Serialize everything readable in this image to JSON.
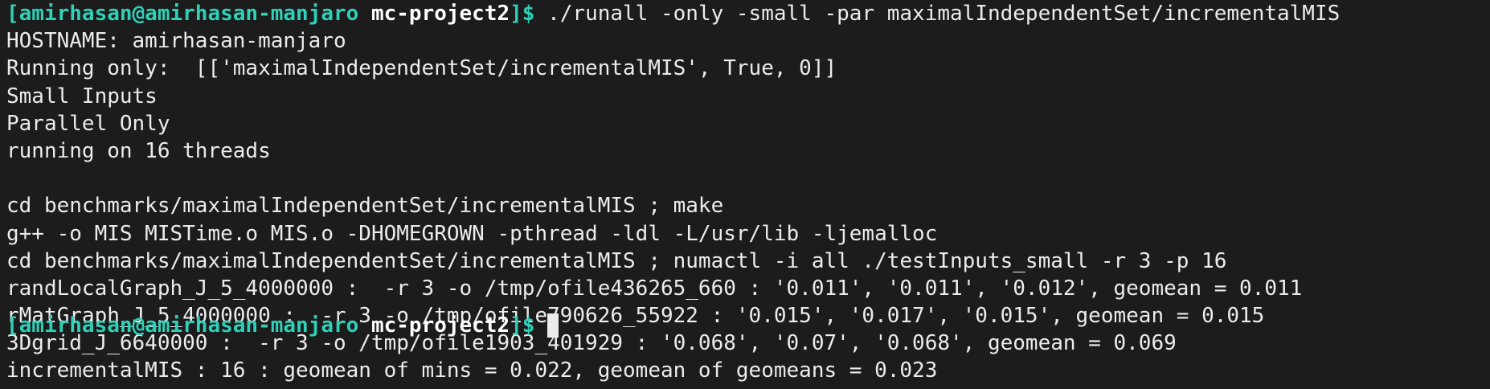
{
  "prompt": {
    "user_host": "[amirhasan@amirhasan-manjaro",
    "cwd": "mc-project2",
    "symbol": "]$",
    "command": " ./runall -only -small -par maximalIndependentSet/incrementalMIS"
  },
  "output_lines": [
    "HOSTNAME: amirhasan-manjaro",
    "Running only:  [['maximalIndependentSet/incrementalMIS', True, 0]]",
    "Small Inputs",
    "Parallel Only",
    "running on 16 threads",
    "",
    "cd benchmarks/maximalIndependentSet/incrementalMIS ; make",
    "g++ -o MIS MISTime.o MIS.o -DHOMEGROWN -pthread -ldl -L/usr/lib -ljemalloc",
    "cd benchmarks/maximalIndependentSet/incrementalMIS ; numactl -i all ./testInputs_small -r 3 -p 16",
    "randLocalGraph_J_5_4000000 :  -r 3 -o /tmp/ofile436265_660 : '0.011', '0.011', '0.012', geomean = 0.011",
    "rMatGraph_J_5_4000000 :  -r 3 -o /tmp/ofile790626_55922 : '0.015', '0.017', '0.015', geomean = 0.015",
    "3Dgrid_J_6640000 :  -r 3 -o /tmp/ofile1903_401929 : '0.068', '0.07', '0.068', geomean = 0.069",
    "incrementalMIS : 16 : geomean of mins = 0.022, geomean of geomeans = 0.023"
  ],
  "next_prompt": {
    "user_host": "[amirhasan@amirhasan-manjaro",
    "cwd": "mc-project2",
    "symbol": "]$ "
  }
}
